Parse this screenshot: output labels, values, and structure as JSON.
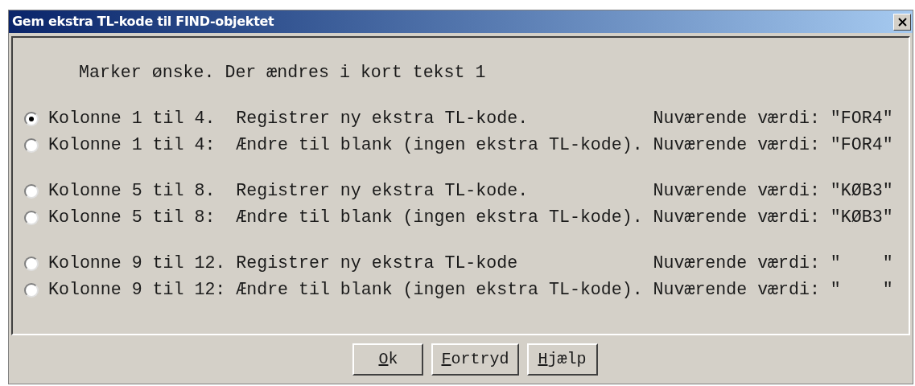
{
  "window": {
    "title": "Gem ekstra TL-kode til FIND-objektet"
  },
  "instruction": "Marker ønske. Der ændres i kort tekst 1",
  "groups": [
    {
      "options": [
        {
          "label": "Kolonne 1 til 4.  Registrer ny ekstra TL-kode.",
          "value": "Nuværende værdi: \"FOR4\"",
          "selected": true
        },
        {
          "label": "Kolonne 1 til 4:  Ændre til blank (ingen ekstra TL-kode).",
          "value": "Nuværende værdi: \"FOR4\"",
          "selected": false
        }
      ]
    },
    {
      "options": [
        {
          "label": "Kolonne 5 til 8.  Registrer ny ekstra TL-kode.",
          "value": "Nuværende værdi: \"KØB3\"",
          "selected": false
        },
        {
          "label": "Kolonne 5 til 8:  Ændre til blank (ingen ekstra TL-kode).",
          "value": "Nuværende værdi: \"KØB3\"",
          "selected": false
        }
      ]
    },
    {
      "options": [
        {
          "label": "Kolonne 9 til 12. Registrer ny ekstra TL-kode",
          "value": "Nuværende værdi: \"    \"",
          "selected": false
        },
        {
          "label": "Kolonne 9 til 12: Ændre til blank (ingen ekstra TL-kode).",
          "value": "Nuværende værdi: \"    \"",
          "selected": false
        }
      ]
    }
  ],
  "buttons": [
    {
      "label": "Ok"
    },
    {
      "label": "Fortryd"
    },
    {
      "label": "Hjælp"
    }
  ]
}
